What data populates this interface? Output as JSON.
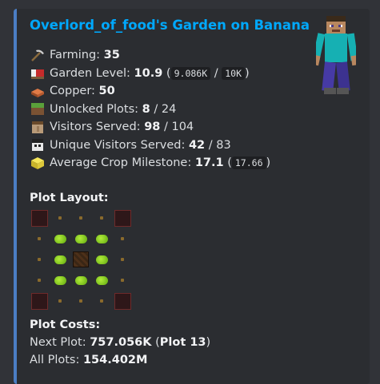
{
  "embed": {
    "title": "Overlord_of_food's Garden on Banana",
    "accent_color": "#4b7ec4"
  },
  "stats": [
    {
      "icon": "pickaxe-icon",
      "label": "Farming:",
      "value": "35"
    },
    {
      "icon": "bed-icon",
      "label": "Garden Level:",
      "value": "10.9",
      "paren_open": "(",
      "code1": "9.086K",
      "sep": "/",
      "code2": "10K",
      "paren_close": ")"
    },
    {
      "icon": "copper-icon",
      "label": "Copper:",
      "value": "50"
    },
    {
      "icon": "grass-block-icon",
      "label": "Unlocked Plots:",
      "value": "8",
      "rest": "/ 24"
    },
    {
      "icon": "villager-head-icon",
      "label": "Visitors Served:",
      "value": "98",
      "rest": "/ 104"
    },
    {
      "icon": "visitor-head-icon",
      "label": "Unique Visitors Served:",
      "value": "42",
      "rest": "/ 83"
    },
    {
      "icon": "milestone-cube-icon",
      "label": "Average Crop Milestone:",
      "value": "17.1",
      "paren_open": "(",
      "code1": "17.66",
      "paren_close": ")"
    }
  ],
  "plot_layout": {
    "heading": "Plot Layout:",
    "rows": [
      [
        "locked",
        "empty",
        "empty",
        "empty",
        "locked"
      ],
      [
        "empty",
        "crop",
        "crop",
        "crop",
        "empty"
      ],
      [
        "empty",
        "crop",
        "barn",
        "crop",
        "empty"
      ],
      [
        "empty",
        "crop",
        "crop",
        "crop",
        "empty"
      ],
      [
        "locked",
        "empty",
        "empty",
        "empty",
        "locked"
      ]
    ]
  },
  "plot_costs": {
    "heading": "Plot Costs:",
    "next_label": "Next Plot:",
    "next_value": "757.056K",
    "next_open": "(",
    "next_plot": "Plot 13",
    "next_close": ")",
    "all_label": "All Plots:",
    "all_value": "154.402M"
  }
}
